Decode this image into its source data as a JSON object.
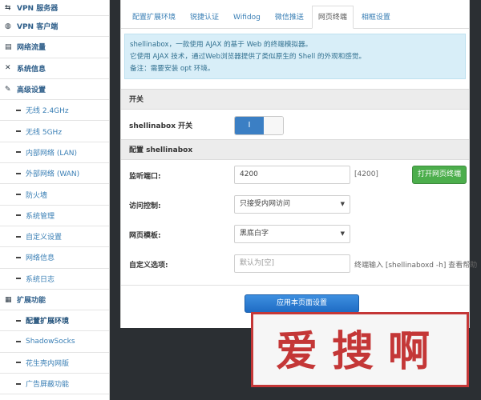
{
  "sidebar": {
    "items": [
      {
        "label": "VPN 服务器",
        "type": "top",
        "icon": "vpn-server-icon",
        "glyph": "⇆"
      },
      {
        "label": "VPN 客户端",
        "type": "top",
        "icon": "globe-icon",
        "glyph": "◍"
      },
      {
        "label": "网络流量",
        "type": "top",
        "icon": "traffic-icon",
        "glyph": "▤"
      },
      {
        "label": "系统信息",
        "type": "top",
        "icon": "shuffle-icon",
        "glyph": "✕"
      },
      {
        "label": "高级设置",
        "type": "top",
        "icon": "wrench-icon",
        "glyph": "✎"
      },
      {
        "label": "无线 2.4GHz",
        "type": "sub"
      },
      {
        "label": "无线 5GHz",
        "type": "sub"
      },
      {
        "label": "内部网络 (LAN)",
        "type": "sub"
      },
      {
        "label": "外部网络 (WAN)",
        "type": "sub"
      },
      {
        "label": "防火墙",
        "type": "sub"
      },
      {
        "label": "系统管理",
        "type": "sub"
      },
      {
        "label": "自定义设置",
        "type": "sub"
      },
      {
        "label": "网络信息",
        "type": "sub"
      },
      {
        "label": "系统日志",
        "type": "sub"
      },
      {
        "label": "扩展功能",
        "type": "top",
        "icon": "extension-icon",
        "glyph": "▦"
      },
      {
        "label": "配置扩展环境",
        "type": "sub",
        "active": true
      },
      {
        "label": "ShadowSocks",
        "type": "sub"
      },
      {
        "label": "花生壳内网版",
        "type": "sub"
      },
      {
        "label": "广告屏蔽功能",
        "type": "sub"
      }
    ]
  },
  "tabs": [
    {
      "label": "配置扩展环境",
      "active": false
    },
    {
      "label": "锐捷认证",
      "active": false
    },
    {
      "label": "Wifidog",
      "active": false
    },
    {
      "label": "微信推送",
      "active": false
    },
    {
      "label": "网页终端",
      "active": true
    },
    {
      "label": "相框设置",
      "active": false
    }
  ],
  "info": {
    "line1": "shellinabox，一款使用 AJAX 的基于 Web 的终端模拟器。",
    "line2": "它使用 AJAX 技术，通过Web浏览器提供了类似原生的 Shell 的外观和感觉。",
    "line3": "备注：需要安装 opt 环境。"
  },
  "switch_section": {
    "title": "开关",
    "label": "shellinabox 开关",
    "toggle_on_text": "I",
    "enabled": true
  },
  "config_section": {
    "title": "配置 shellinabox",
    "port": {
      "label": "监听端口:",
      "value": "4200",
      "hint": "[4200]",
      "button": "打开网页终端"
    },
    "access": {
      "label": "访问控制:",
      "value": "只接受内网访问"
    },
    "template": {
      "label": "网页模板:",
      "value": "黑底白字"
    },
    "custom": {
      "label": "自定义选项:",
      "placeholder": "默认为[空]",
      "hint": "终端输入 [shellinaboxd -h] 查看帮助"
    }
  },
  "apply_button": "应用本页面设置",
  "watermark": {
    "text": "爱搜啊"
  },
  "colors": {
    "accent_blue": "#3b7fc4",
    "link_blue": "#3a7fb5",
    "green": "#4cae4c",
    "info_bg": "#d8eef8",
    "watermark_red": "#c43737",
    "background": "#2b2f33"
  }
}
